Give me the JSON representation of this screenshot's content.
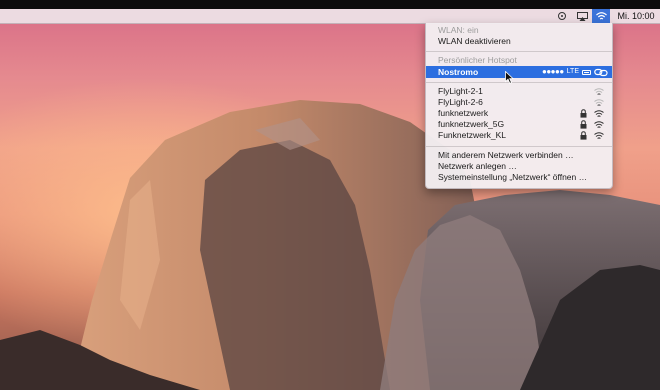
{
  "menubar": {
    "record_icon": "record-icon",
    "airplay_icon": "airplay-icon",
    "wifi_icon": "wifi-icon",
    "clock": "Mi. 10:00"
  },
  "wifi_menu": {
    "status": "WLAN: ein",
    "toggle": "WLAN deaktivieren",
    "hotspot_heading": "Persönlicher Hotspot",
    "hotspot": {
      "name": "Nostromo",
      "signal": "●●●●●",
      "network_type": "LTE",
      "battery_icon": "battery-icon",
      "link_icon": "link-icon"
    },
    "networks": [
      {
        "name": "FlyLight-2-1",
        "locked": false,
        "signal_strength": "weak"
      },
      {
        "name": "FlyLight-2-6",
        "locked": false,
        "signal_strength": "weak"
      },
      {
        "name": "funknetzwerk",
        "locked": true,
        "signal_strength": "full"
      },
      {
        "name": "funknetzwerk_5G",
        "locked": true,
        "signal_strength": "full"
      },
      {
        "name": "Funknetzwerk_KL",
        "locked": true,
        "signal_strength": "full"
      }
    ],
    "actions": [
      "Mit anderem Netzwerk verbinden …",
      "Netzwerk anlegen …",
      "Systemeinstellung „Netzwerk“ öffnen …"
    ]
  },
  "colors": {
    "selection": "#2c6ee0",
    "wifi_highlight": "#3b73d9",
    "menu_bg": "#f3eef1"
  }
}
